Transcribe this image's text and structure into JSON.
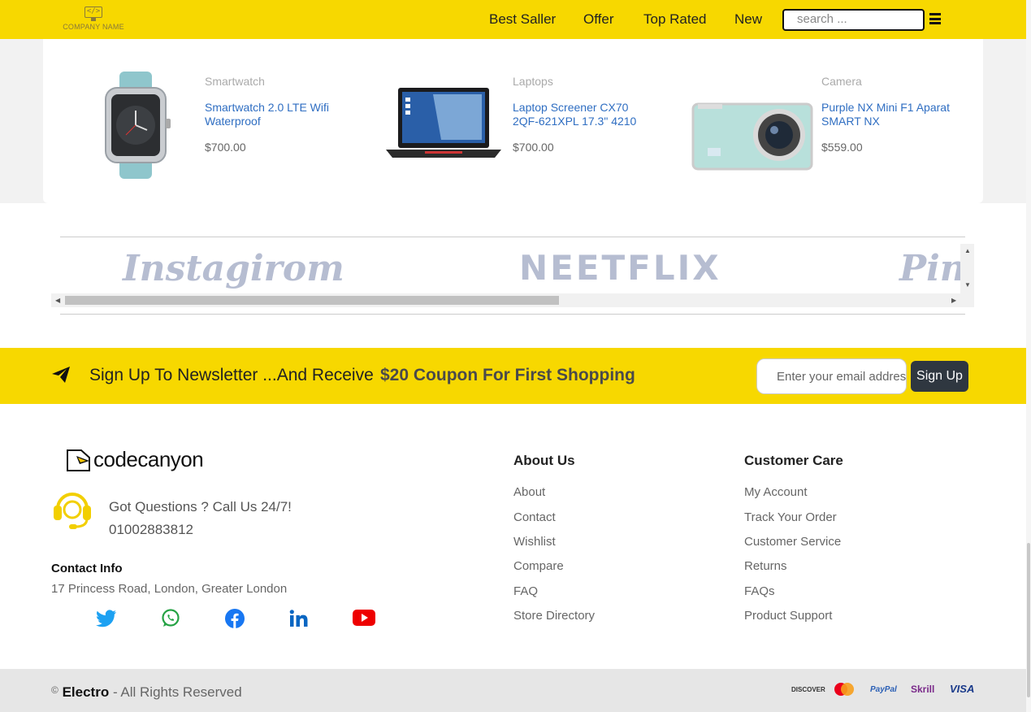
{
  "header": {
    "logo_text": "COMPANY NAME",
    "logo_mark": "</>",
    "nav": [
      "Best Saller",
      "Offer",
      "Top Rated",
      "New"
    ],
    "search_placeholder": "search ...",
    "accent_color": "#f7d800"
  },
  "products": [
    {
      "category": "Smartwatch",
      "name": "Smartwatch 2.0 LTE Wifi Waterproof",
      "price": "$700.00",
      "image": "smartwatch-image"
    },
    {
      "category": "Laptops",
      "name": "Laptop Screener CX70 2QF-621XPL 17.3\" 4210",
      "price": "$700.00",
      "image": "laptop-image"
    },
    {
      "category": "Camera",
      "name": "Purple NX Mini F1 Aparat SMART NX",
      "price": "$559.00",
      "image": "camera-image"
    }
  ],
  "brands": [
    "Instagirom",
    "NEETFLIX",
    "Pin"
  ],
  "newsletter": {
    "text": "Sign Up To Newsletter ...And Receive",
    "coupon": "$20 Coupon For First Shopping",
    "email_placeholder": "Enter your email address",
    "button": "Sign Up"
  },
  "footer": {
    "brand": "codecanyon",
    "questions": "Got Questions ? Call Us 24/7!",
    "phone": "01002883812",
    "contact_title": "Contact Info",
    "address": "17 Princess Road, London, Greater London",
    "social": [
      "twitter-icon",
      "whatsapp-icon",
      "facebook-icon",
      "linkedin-icon",
      "youtube-icon"
    ],
    "about_title": "About Us",
    "about_links": [
      "About",
      "Contact",
      "Wishlist",
      "Compare",
      "FAQ",
      "Store Directory"
    ],
    "care_title": "Customer Care",
    "care_links": [
      "My Account",
      "Track Your Order",
      "Customer Service",
      "Returns",
      "FAQs",
      "Product Support"
    ]
  },
  "bottom": {
    "copyright_symbol": "©",
    "brand": "Electro",
    "rights": "- All Rights Reserved",
    "payments": [
      "DISCOVER",
      "mastercard",
      "PayPal",
      "Skrill",
      "VISA"
    ]
  }
}
